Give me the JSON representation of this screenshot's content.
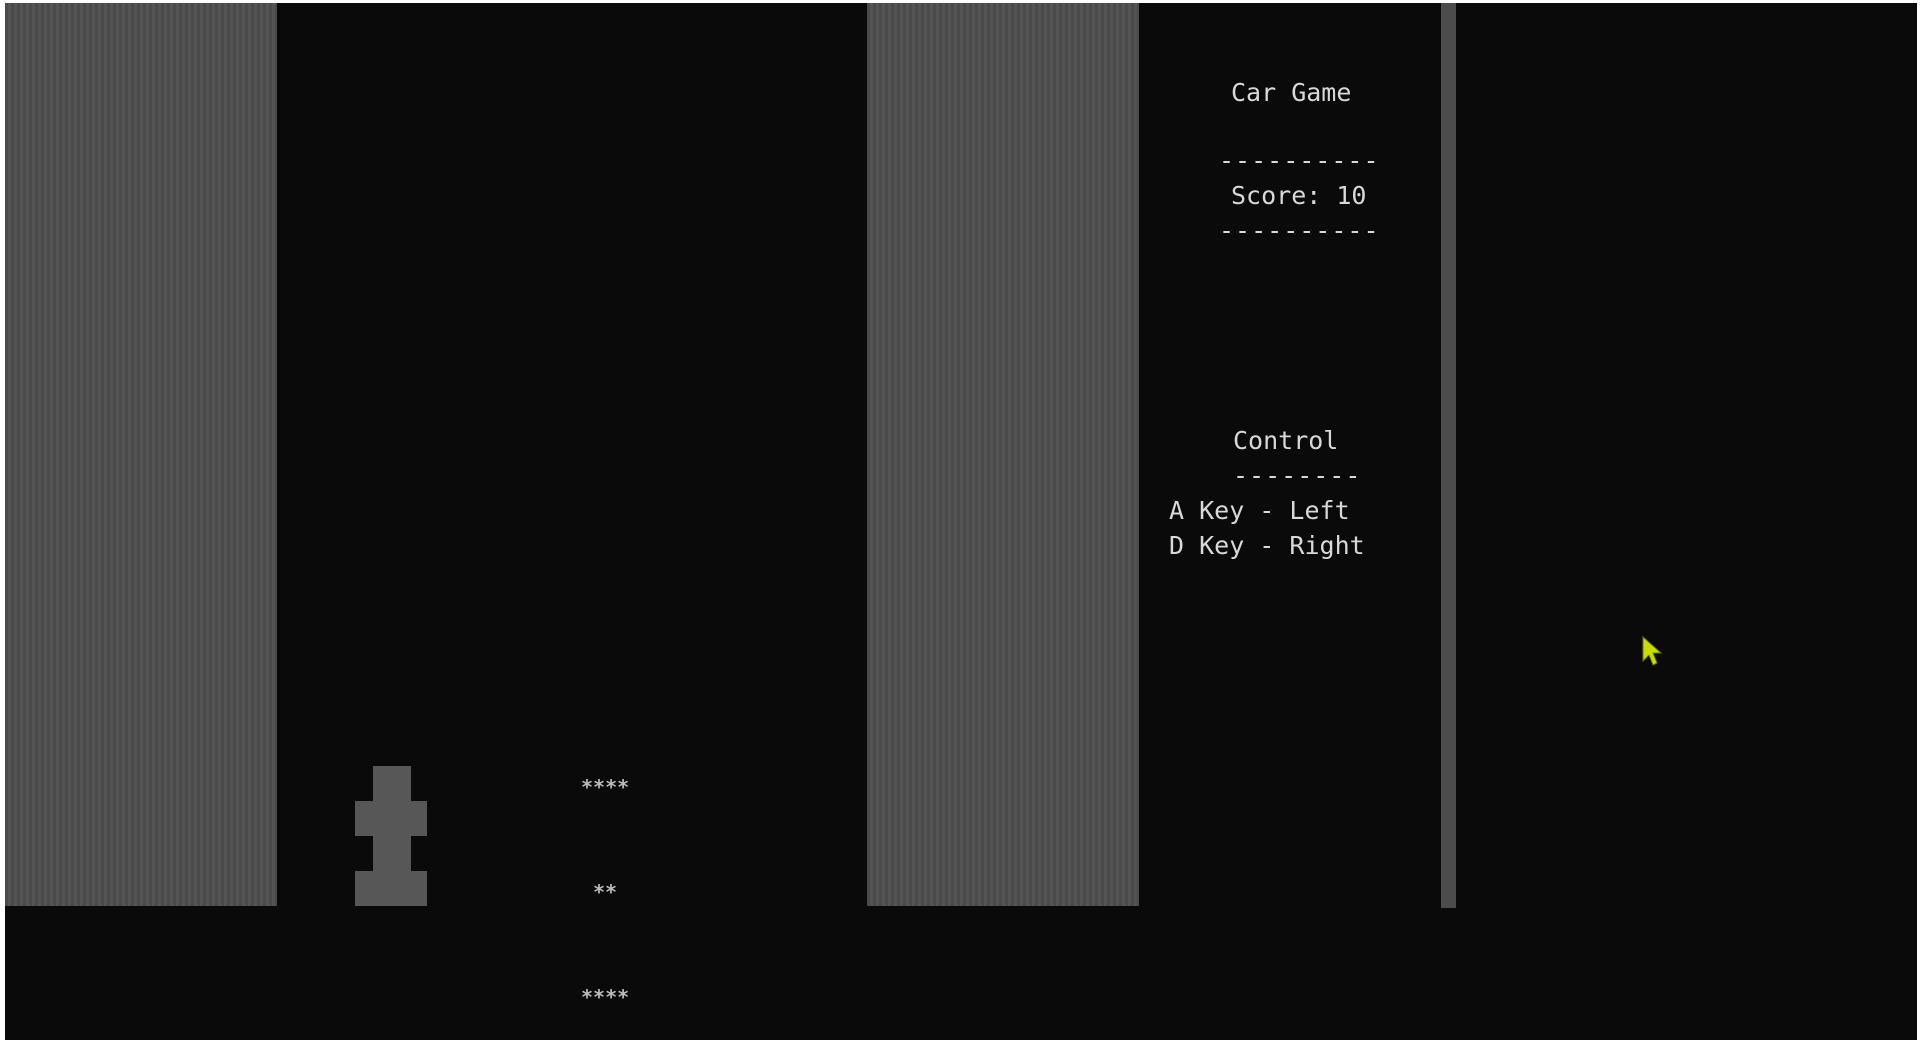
{
  "game": {
    "title": "Car Game",
    "separator_long": "----------",
    "score_label": "Score:",
    "score_value": "10",
    "controls": {
      "title": "Control",
      "separator": "--------",
      "left": "A Key - Left",
      "right": "D Key - Right"
    },
    "enemy_car_rows": [
      "****",
      "**",
      "****"
    ]
  },
  "colors": {
    "background": "#0a0a0a",
    "wall": "#4f4f4f",
    "text": "#d8d8d8",
    "cursor": "#c8e000"
  },
  "icons": {
    "cursor": "arrow-cursor-icon"
  }
}
